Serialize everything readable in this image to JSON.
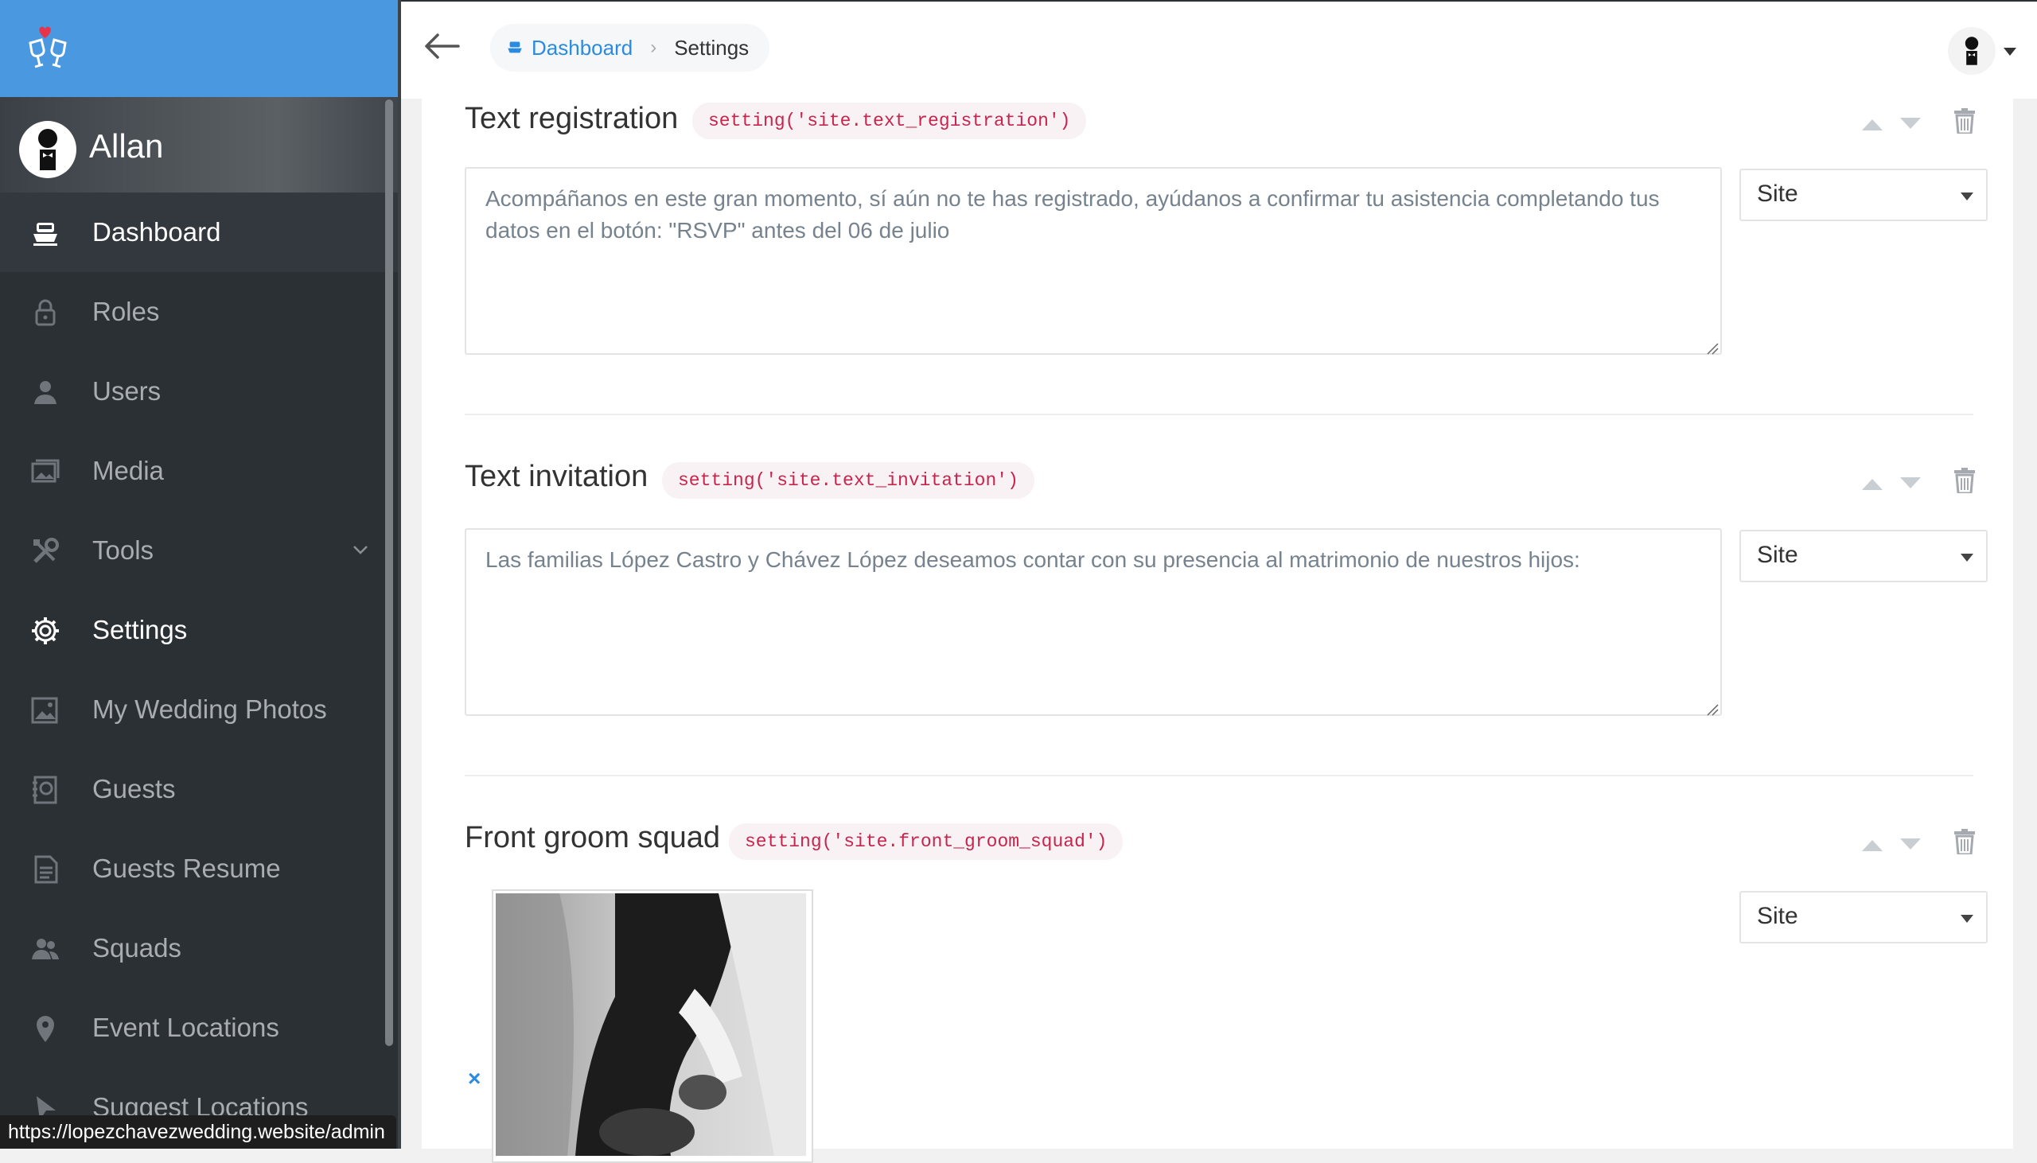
{
  "sidebar": {
    "profile_name": "Allan",
    "items": [
      {
        "label": "Dashboard",
        "icon": "boat-icon"
      },
      {
        "label": "Roles",
        "icon": "lock-icon"
      },
      {
        "label": "Users",
        "icon": "person-icon"
      },
      {
        "label": "Media",
        "icon": "images-icon"
      },
      {
        "label": "Tools",
        "icon": "tools-icon"
      },
      {
        "label": "Settings",
        "icon": "gear-icon"
      },
      {
        "label": "My Wedding Photos",
        "icon": "photo-icon"
      },
      {
        "label": "Guests",
        "icon": "book-icon"
      },
      {
        "label": "Guests Resume",
        "icon": "document-icon"
      },
      {
        "label": "Squads",
        "icon": "people-icon"
      },
      {
        "label": "Event Locations",
        "icon": "location-icon"
      },
      {
        "label": "Suggest Locations",
        "icon": "pointer-icon"
      }
    ]
  },
  "breadcrumb": {
    "dashboard": "Dashboard",
    "current": "Settings"
  },
  "settings": [
    {
      "title": "Text registration",
      "code": "setting('site.text_registration')",
      "value": "Acompáñanos en este gran momento, sí aún no te has registrado, ayúdanos a confirmar tu asistencia completando tus datos en el botón: \"RSVP\" antes del 06 de julio",
      "group": "Site"
    },
    {
      "title": "Text invitation",
      "code": "setting('site.text_invitation')",
      "value": "Las familias López Castro y Chávez López deseamos contar con su presencia al matrimonio de nuestros hijos:",
      "group": "Site"
    },
    {
      "title": "Front groom squad",
      "code": "setting('site.front_groom_squad')",
      "group": "Site",
      "remove_label": "×"
    }
  ],
  "statusbar": {
    "url": "https://lopezchavezwedding.website/admin"
  },
  "colors": {
    "brand": "#4a98e0",
    "sidebar": "#2b3035",
    "link": "#2b8be0",
    "code": "#c7254e"
  }
}
